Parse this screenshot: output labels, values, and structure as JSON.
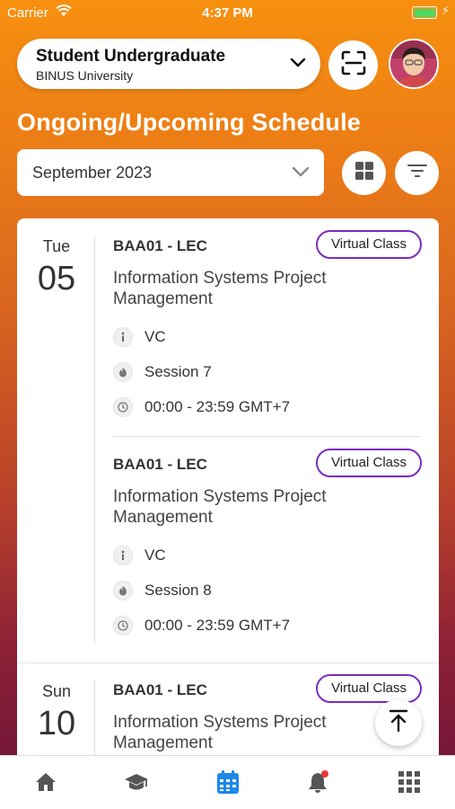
{
  "status_bar": {
    "carrier": "Carrier",
    "time": "4:37 PM"
  },
  "header": {
    "role_title": "Student Undergraduate",
    "institution": "BINUS University"
  },
  "page_title": "Ongoing/Upcoming Schedule",
  "filter": {
    "month": "September 2023"
  },
  "schedule": {
    "day1": {
      "dow": "Tue",
      "day": "05",
      "classes": [
        {
          "code": "BAA01 - LEC",
          "badge": "Virtual Class",
          "title": "Information Systems Project Management",
          "mode": "VC",
          "session": "Session 7",
          "time": "00:00 - 23:59 GMT+7"
        },
        {
          "code": "BAA01 - LEC",
          "badge": "Virtual Class",
          "title": "Information Systems Project Management",
          "mode": "VC",
          "session": "Session 8",
          "time": "00:00 - 23:59 GMT+7"
        }
      ]
    },
    "day2": {
      "dow": "Sun",
      "day": "10",
      "classes": [
        {
          "code": "BAA01 - LEC",
          "badge": "Virtual Class",
          "title": "Information Systems Project Management"
        }
      ]
    }
  },
  "tabs": [
    "home",
    "courses",
    "schedule",
    "notifications",
    "menu"
  ],
  "colors": {
    "accent": "#f7900f",
    "badge_border": "#7b2cbf",
    "active_tab": "#1e88e5",
    "notification_dot": "#e53935"
  },
  "icons": [
    "wifi-icon",
    "battery-icon",
    "chevron-down-icon",
    "scan-icon",
    "grid-view-icon",
    "filter-icon",
    "info-icon",
    "session-icon",
    "clock-icon",
    "scroll-top-icon",
    "home-icon",
    "graduation-cap-icon",
    "calendar-icon",
    "bell-icon",
    "apps-grid-icon"
  ]
}
